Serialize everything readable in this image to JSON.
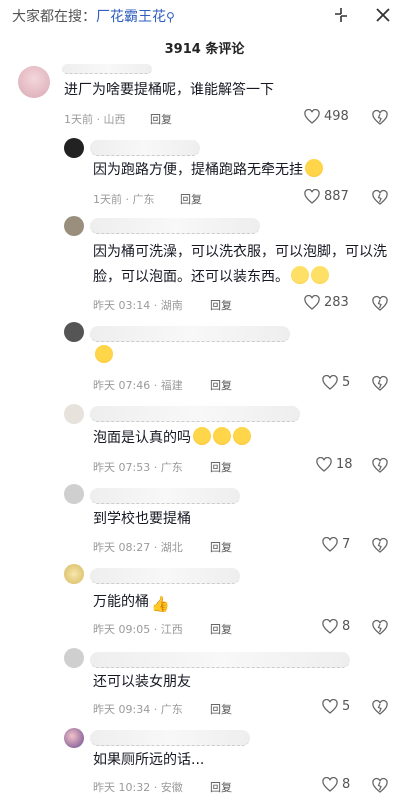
{
  "search": {
    "prefix": "大家都在搜：",
    "term": "厂花霸王花"
  },
  "comments_header": {
    "count_text": "3914 条评论"
  },
  "comments": [
    {
      "text": "进厂为啥要提桶呢，谁能解答一下",
      "time": "1天前",
      "location": "山西",
      "reply_label": "回复",
      "likes": "498"
    },
    {
      "text": "因为跑路方便，提桶跑路无牵无挂",
      "time": "1天前",
      "location": "广东",
      "reply_label": "回复",
      "likes": "887"
    },
    {
      "text": "因为桶可洗澡，可以洗衣服，可以泡脚，可以洗脸，可以泡面。还可以装东西。",
      "time": "昨天 03:14",
      "location": "湖南",
      "reply_label": "回复",
      "likes": "283"
    },
    {
      "text": "",
      "time": "昨天 07:46",
      "location": "福建",
      "reply_label": "回复",
      "likes": "5"
    },
    {
      "text": "泡面是认真的吗",
      "time": "昨天 07:53",
      "location": "广东",
      "reply_label": "回复",
      "likes": "18"
    },
    {
      "text": "到学校也要提桶",
      "time": "昨天 08:27",
      "location": "湖北",
      "reply_label": "回复",
      "likes": "7"
    },
    {
      "text": "万能的桶",
      "time": "昨天 09:05",
      "location": "江西",
      "reply_label": "回复",
      "likes": "8"
    },
    {
      "text": "还可以装女朋友",
      "time": "昨天 09:34",
      "location": "广东",
      "reply_label": "回复",
      "likes": "5"
    },
    {
      "text": "如果厕所远的话...",
      "time": "昨天 10:32",
      "location": "安徽",
      "reply_label": "回复",
      "likes": "8"
    }
  ],
  "colors": {
    "search_term": "#2f5fbf",
    "meta_gray": "#9a9a9a"
  }
}
